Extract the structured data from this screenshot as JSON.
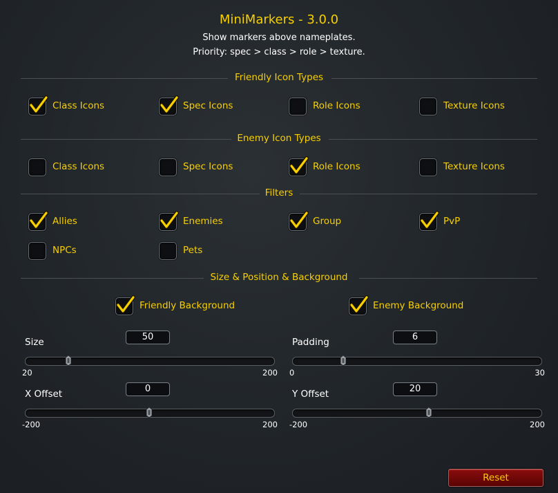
{
  "header": {
    "title": "MiniMarkers - 3.0.0",
    "line1": "Show markers above nameplates.",
    "line2": "Priority: spec > class > role > texture."
  },
  "sections": {
    "friendly": "Friendly Icon Types",
    "enemy": "Enemy Icon Types",
    "filters": "Filters",
    "size": "Size & Position & Background"
  },
  "friendly_icons": [
    {
      "label": "Class Icons",
      "checked": true
    },
    {
      "label": "Spec Icons",
      "checked": true
    },
    {
      "label": "Role Icons",
      "checked": false
    },
    {
      "label": "Texture Icons",
      "checked": false
    }
  ],
  "enemy_icons": [
    {
      "label": "Class Icons",
      "checked": false
    },
    {
      "label": "Spec Icons",
      "checked": false
    },
    {
      "label": "Role Icons",
      "checked": true
    },
    {
      "label": "Texture Icons",
      "checked": false
    }
  ],
  "filters": [
    {
      "label": "Allies",
      "checked": true
    },
    {
      "label": "Enemies",
      "checked": true
    },
    {
      "label": "Group",
      "checked": true
    },
    {
      "label": "PvP",
      "checked": true
    },
    {
      "label": "NPCs",
      "checked": false
    },
    {
      "label": "Pets",
      "checked": false
    }
  ],
  "backgrounds": [
    {
      "label": "Friendly Background",
      "checked": true
    },
    {
      "label": "Enemy Background",
      "checked": true
    }
  ],
  "sliders": [
    {
      "label": "Size",
      "value": "50",
      "min": "20",
      "max": "200",
      "fraction": 0.167
    },
    {
      "label": "Padding",
      "value": "6",
      "min": "0",
      "max": "30",
      "fraction": 0.2
    },
    {
      "label": "X Offset",
      "value": "0",
      "min": "-200",
      "max": "200",
      "fraction": 0.5
    },
    {
      "label": "Y Offset",
      "value": "20",
      "min": "-200",
      "max": "200",
      "fraction": 0.55
    }
  ],
  "reset_label": "Reset",
  "colors": {
    "accent": "#f8d000",
    "reset_bg": "#6e0707"
  }
}
